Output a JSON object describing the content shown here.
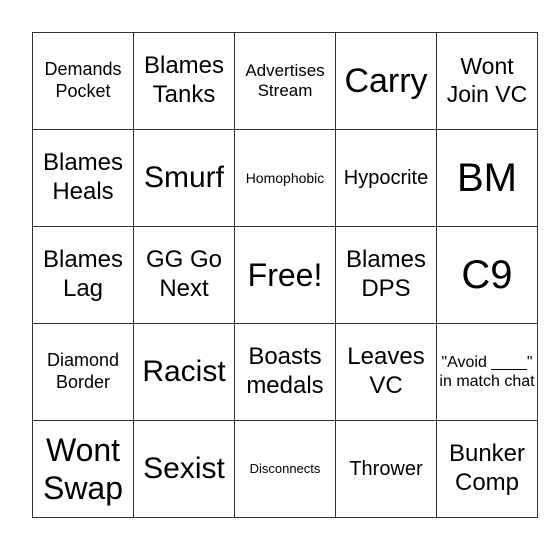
{
  "card": {
    "rows": [
      [
        {
          "text": "Demands Pocket",
          "size": 18
        },
        {
          "text": "Blames Tanks",
          "size": 24
        },
        {
          "text": "Advertises Stream",
          "size": 17
        },
        {
          "text": "Carry",
          "size": 34
        },
        {
          "text": "Wont Join VC",
          "size": 23
        }
      ],
      [
        {
          "text": "Blames Heals",
          "size": 24
        },
        {
          "text": "Smurf",
          "size": 30
        },
        {
          "text": "Homophobic",
          "size": 14
        },
        {
          "text": "Hypocrite",
          "size": 20
        },
        {
          "text": "BM",
          "size": 40
        }
      ],
      [
        {
          "text": "Blames Lag",
          "size": 24
        },
        {
          "text": "GG Go Next",
          "size": 24
        },
        {
          "text": "Free!",
          "size": 32
        },
        {
          "text": "Blames DPS",
          "size": 24
        },
        {
          "text": "C9",
          "size": 40
        }
      ],
      [
        {
          "text": "Diamond Border",
          "size": 18
        },
        {
          "text": "Racist",
          "size": 30
        },
        {
          "text": "Boasts medals",
          "size": 24
        },
        {
          "text": "Leaves VC",
          "size": 24
        },
        {
          "text": "\"Avoid ____\" in match chat",
          "size": 16
        }
      ],
      [
        {
          "text": "Wont Swap",
          "size": 32
        },
        {
          "text": "Sexist",
          "size": 30
        },
        {
          "text": "Disconnects",
          "size": 13
        },
        {
          "text": "Thrower",
          "size": 20
        },
        {
          "text": "Bunker Comp",
          "size": 24
        }
      ]
    ]
  }
}
